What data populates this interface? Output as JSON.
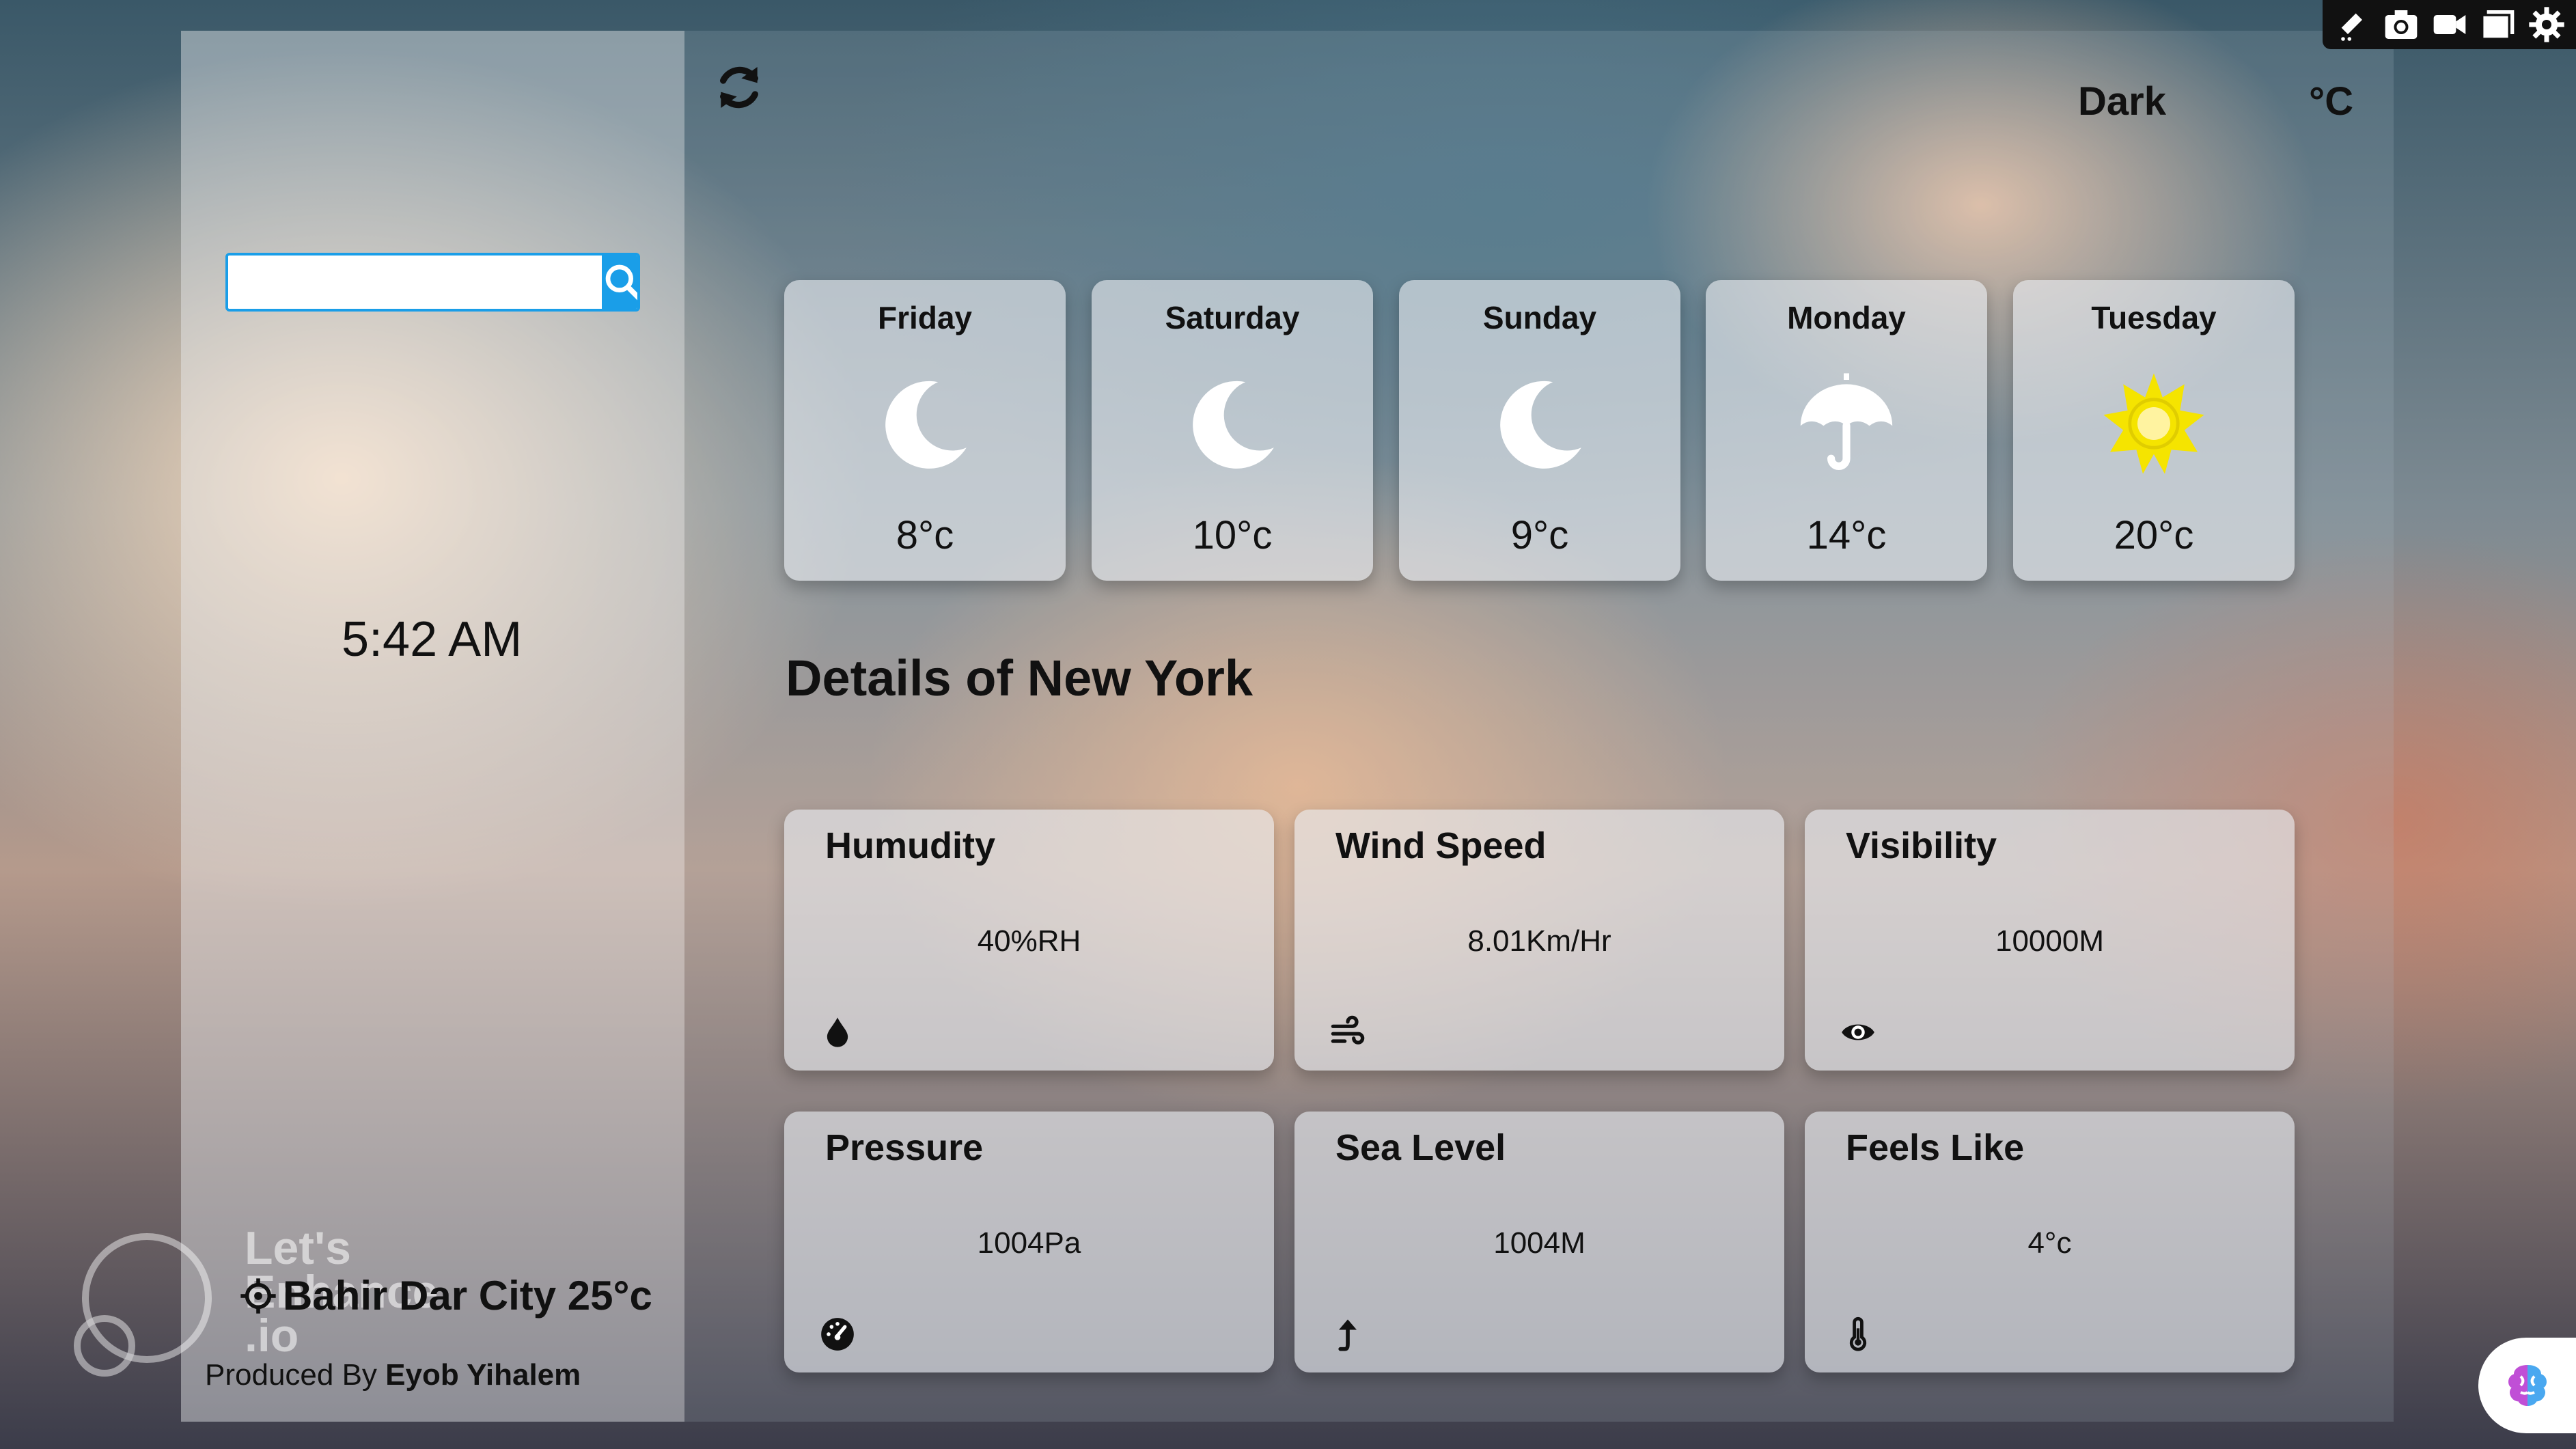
{
  "search": {
    "value": "",
    "placeholder": ""
  },
  "clock": {
    "time": "5:42 AM"
  },
  "location": {
    "text": "Bahir Dar City 25°c"
  },
  "credit": {
    "prefix": "Produced By ",
    "author": "Eyob Yihalem"
  },
  "watermark": {
    "line1": "Let's",
    "line2": "Enhance",
    "line3": ".io"
  },
  "header": {
    "theme_toggle": "Dark",
    "unit_toggle": "°C"
  },
  "forecast": [
    {
      "day": "Friday",
      "temp": "8°c",
      "icon": "moon-icon"
    },
    {
      "day": "Saturday",
      "temp": "10°c",
      "icon": "moon-icon"
    },
    {
      "day": "Sunday",
      "temp": "9°c",
      "icon": "moon-icon"
    },
    {
      "day": "Monday",
      "temp": "14°c",
      "icon": "umbrella-icon"
    },
    {
      "day": "Tuesday",
      "temp": "20°c",
      "icon": "sun-icon"
    }
  ],
  "details": {
    "title": "Details of New York",
    "items": [
      {
        "label": "Humudity",
        "value": "40%RH",
        "icon": "droplet-icon"
      },
      {
        "label": "Wind Speed",
        "value": "8.01Km/Hr",
        "icon": "wind-icon"
      },
      {
        "label": "Visibility",
        "value": "10000M",
        "icon": "eye-icon"
      },
      {
        "label": "Pressure",
        "value": "1004Pa",
        "icon": "gauge-icon"
      },
      {
        "label": "Sea Level",
        "value": "1004M",
        "icon": "arrow-up-icon"
      },
      {
        "label": "Feels Like",
        "value": "4°c",
        "icon": "thermometer-icon"
      }
    ]
  },
  "colors": {
    "accent": "#1a9ee8",
    "sun": "#f5e400",
    "text": "#111111"
  }
}
